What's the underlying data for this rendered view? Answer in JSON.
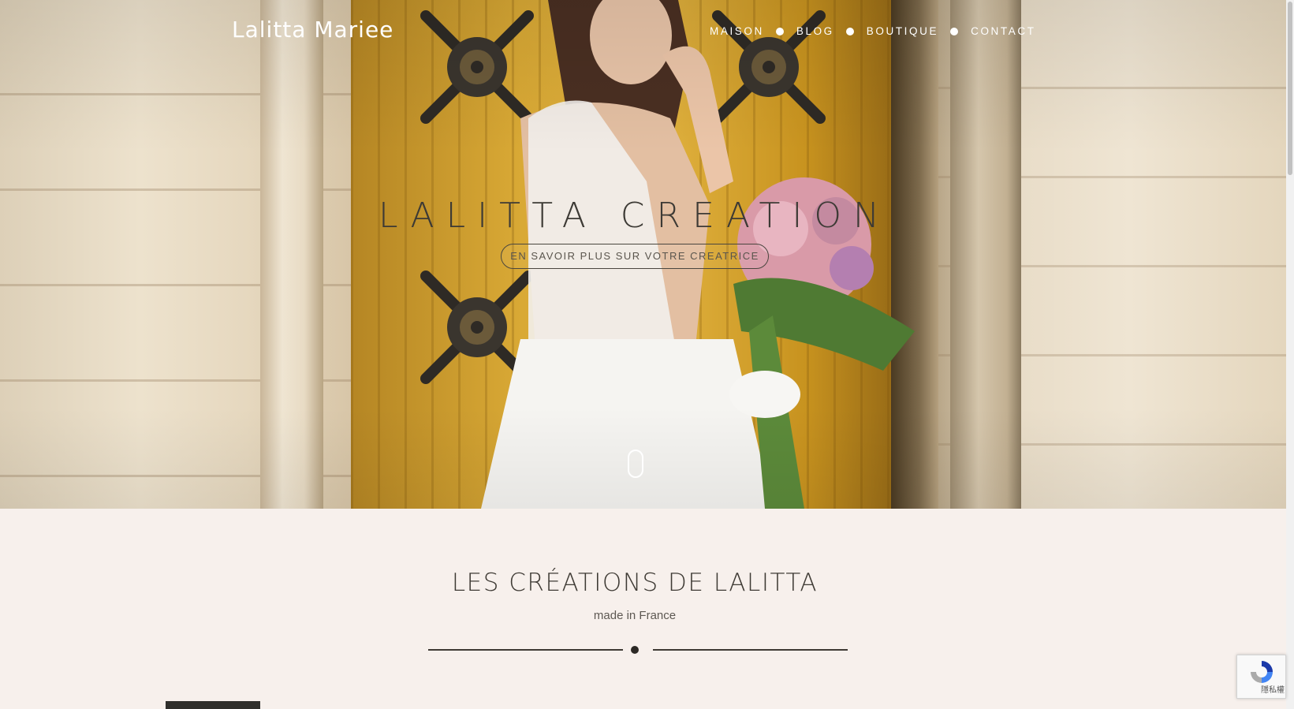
{
  "header": {
    "logo": "Lalitta Mariee",
    "nav": [
      {
        "label": "MAISON"
      },
      {
        "label": "BLOG"
      },
      {
        "label": "BOUTIQUE"
      },
      {
        "label": "CONTACT"
      }
    ]
  },
  "hero": {
    "title": "LALITTA CREATION",
    "cta": "EN SAVOIR PLUS SUR VOTRE CREATRICE"
  },
  "section": {
    "title": "LES CRÉATIONS DE LALITTA",
    "subtitle": "made in France"
  },
  "recaptcha": {
    "text": "隱私權 - 條"
  },
  "colors": {
    "page_bg": "#f7f0ec",
    "heading": "#3e3a34",
    "nav_text": "#ffffff"
  }
}
